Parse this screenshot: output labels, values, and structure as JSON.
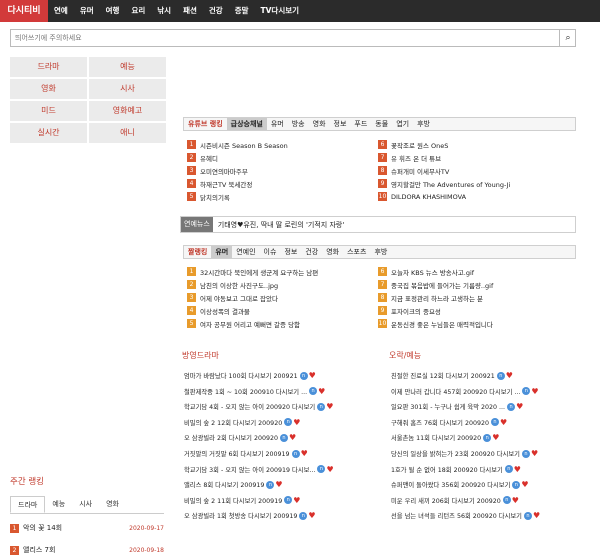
{
  "logo": "다시티비",
  "nav": [
    "연예",
    "유머",
    "여행",
    "요리",
    "낚시",
    "패션",
    "건강",
    "증말",
    "TV다시보기"
  ],
  "search": {
    "placeholder": "띄어쓰기에 주의하세요",
    "icon": "search-icon"
  },
  "categories": [
    "드라마",
    "예능",
    "영화",
    "시사",
    "미드",
    "영화예고",
    "실시간",
    "애니"
  ],
  "youtube": {
    "tabs": [
      "유튜브 랭킹",
      "급상승채널",
      "유머",
      "방송",
      "영화",
      "정보",
      "푸드",
      "동물",
      "엽기",
      "후방"
    ],
    "items": [
      "시즌비시즌 Season B Season",
      "유혜디",
      "오미연의마마주부",
      "하재근TV 북세간정",
      "닭치의기록",
      "꽃작조로 원스 OneS",
      "유 휘즈 온 더 튜브",
      "슈퍼개미 이세무사TV",
      "영지할걸만 The Adventures of Young-Ji",
      "DILDORA KHASHIMOVA"
    ]
  },
  "news": {
    "label": "연예뉴스",
    "text": "기태영♥유진, 딱내 딸 로린의 '기적지 자랑'"
  },
  "hot": {
    "tabs": [
      "짤랭킹",
      "유머",
      "연예인",
      "이슈",
      "정보",
      "건강",
      "영화",
      "스포츠",
      "후방"
    ],
    "items": [
      "32시간마다 북인에게 생군계 요구하는 남편",
      "남친의 이상한 사진구도..jpg",
      "어제 야동보고 그대로 잡았다",
      "이상성폭의 결과물",
      "여자 공무원 어리고 예뻐면 갈증 당함",
      "오늘자 KBS 뉴스 방송사고.gif",
      "중국집 볶음밥에 들어가는 기름량..gif",
      "지금 표정관리 하느라 고생하는 분",
      "포자이크의 중요성",
      "운동신경 좋은 누님들은 매력적입니다"
    ]
  },
  "drama": {
    "title": "방영드라마",
    "items": [
      "엄마가 바람났다 100회 다시보기 200921",
      "철판제작중 1회 ~ 10회 200910 다시보기 ...",
      "학교기담 4회 - 오지 않는 아이 200920 다시보기",
      "비밀의 숲 2 12회 다시보기 200920",
      "오 삼광빌라 2회 다시보기 200920",
      "거짓말의 거짓말 6회 다시보기 200919",
      "학교기담 3회 - 오지 않는 아이 200919 다시보...",
      "앨리스 8회 다시보기 200919",
      "비밀의 숲 2 11회 다시보기 200919",
      "오 삼광빌라 1회 첫방송 다시보기 200919"
    ]
  },
  "variety": {
    "title": "오락/예능",
    "items": [
      "친절한 진료실 12회 다시보기 200921",
      "이제 만나러 갑니다 457회 200920 다시보기 ...",
      "일요판 301회 - 누구나 쉽게 육막 2020 ...",
      "구해줘 홈즈 76회 다시보기 200920",
      "서울촌놈 11회 다시보기 200920",
      "당신의 일상을 밝혀는가 23회 200920 다시보기",
      "1호가 될 순 없어 18회 200920 다시보기",
      "슈퍼맨이 돌아왔다 356회 200920 다시보기",
      "미운 우리 새끼 206회 다시보기 200920",
      "선을 넘는 녀석들 리턴즈 56회 200920 다시보기"
    ]
  },
  "weekly": {
    "title": "주간 랭킹",
    "tabs": [
      "드라마",
      "예능",
      "시사",
      "영화"
    ],
    "items": [
      {
        "title": "악의 꽃 14회",
        "date": "2020-09-17"
      },
      {
        "title": "앨리스 7회",
        "date": "2020-09-18"
      }
    ]
  },
  "colors": {
    "accent": "#c0392b",
    "logo_bg": "#d23a3a",
    "rank_red": "#d9572f",
    "rank_orange": "#e89b2b"
  }
}
